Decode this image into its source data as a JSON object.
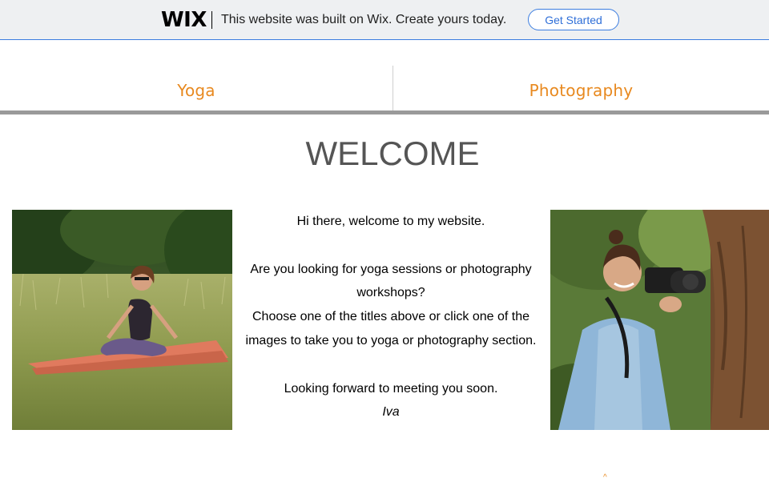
{
  "wix_banner": {
    "logo": "WIX",
    "message": "This website was built on Wix. Create yours today.",
    "cta_label": "Get Started"
  },
  "nav": {
    "items": [
      {
        "label": "Yoga"
      },
      {
        "label": "Photography"
      }
    ]
  },
  "main": {
    "title": "WELCOME",
    "intro": {
      "lines": [
        "Hi there, welcome to my website.",
        "Are you looking for yoga sessions or photography workshops?",
        " Choose one of the titles above or click one of the images to take you to yoga or photography section.",
        "Looking forward to meeting you soon."
      ],
      "signature": "Iva"
    }
  },
  "colors": {
    "accent": "#e8891f",
    "banner_bg": "#eef0f2",
    "banner_border": "#3b7de0",
    "title": "#555555",
    "nav_bar": "#9a9a9a"
  },
  "icons": {
    "yoga_image": "woman-meditating-photo",
    "photography_image": "woman-with-camera-photo"
  }
}
